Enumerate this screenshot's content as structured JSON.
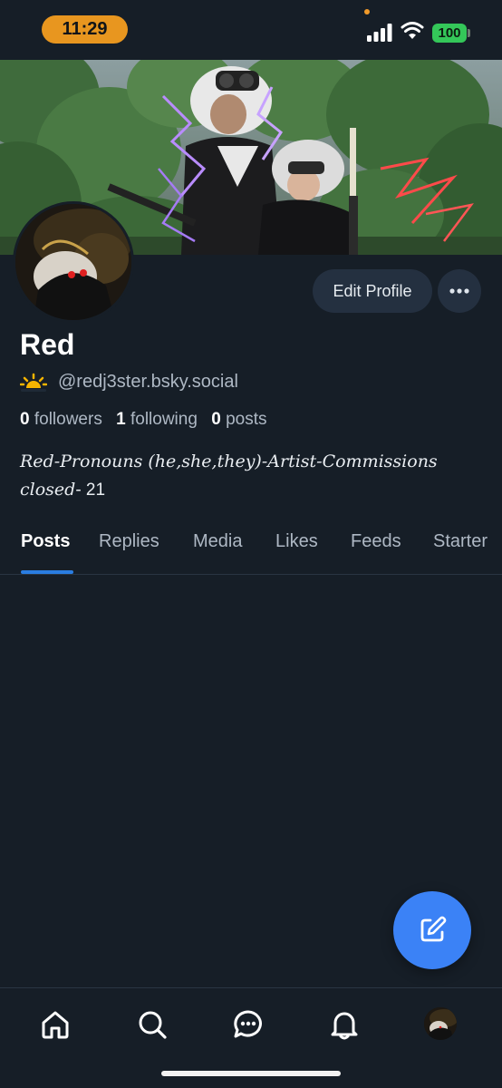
{
  "status_bar": {
    "time": "11:29",
    "battery": "100",
    "colors": {
      "time_pill": "#e8961f",
      "battery": "#34c759"
    }
  },
  "profile": {
    "display_name": "Red",
    "handle": "@redj3ster.bsky.social",
    "handle_icon": "sunrise-icon",
    "stats": {
      "followers_count": "0",
      "followers_label": "followers",
      "following_count": "1",
      "following_label": "following",
      "posts_count": "0",
      "posts_label": "posts"
    },
    "bio_line1": "Red-Pronouns (he,she,they)-Artist-Commissions",
    "bio_line2_script": "closed",
    "bio_line2_rest": "- 21"
  },
  "actions": {
    "edit_profile_label": "Edit Profile",
    "more_icon": "ellipsis-icon"
  },
  "tabs": [
    {
      "label": "Posts",
      "active": true
    },
    {
      "label": "Replies",
      "active": false
    },
    {
      "label": "Media",
      "active": false
    },
    {
      "label": "Likes",
      "active": false
    },
    {
      "label": "Feeds",
      "active": false
    },
    {
      "label": "Starter",
      "active": false
    }
  ],
  "fab": {
    "icon": "compose-icon",
    "color": "#3b82f6"
  },
  "bottom_nav": [
    {
      "icon": "home-icon"
    },
    {
      "icon": "search-icon"
    },
    {
      "icon": "chat-icon"
    },
    {
      "icon": "bell-icon"
    },
    {
      "icon": "profile-avatar"
    }
  ],
  "theme": {
    "background": "#161e27",
    "accent": "#2a7de1",
    "button_bg": "#243040"
  }
}
